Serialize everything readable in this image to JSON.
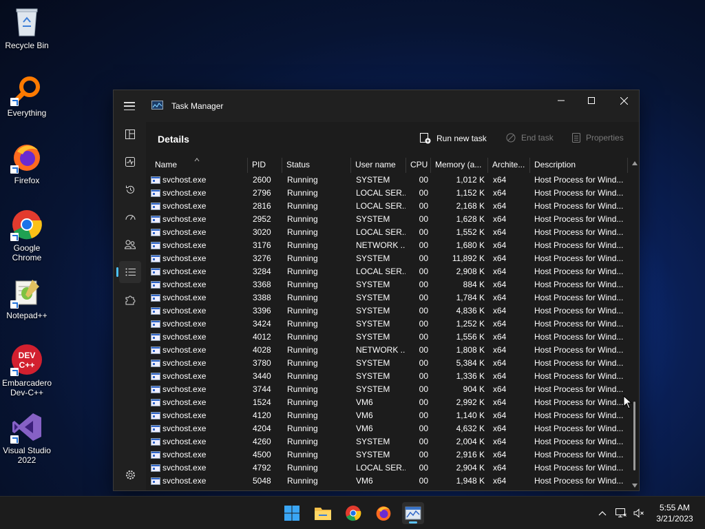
{
  "desktop": {
    "icons": [
      {
        "label": "Recycle Bin"
      },
      {
        "label": "Everything"
      },
      {
        "label": "Firefox"
      },
      {
        "label": "Google Chrome"
      },
      {
        "label": "Notepad++"
      },
      {
        "label": "Embarcadero Dev-C++"
      },
      {
        "label": "Visual Studio 2022"
      }
    ]
  },
  "window": {
    "title": "Task Manager",
    "page_title": "Details",
    "commands": {
      "run_new_task": "Run new task",
      "end_task": "End task",
      "properties": "Properties"
    },
    "columns": [
      "Name",
      "PID",
      "Status",
      "User name",
      "CPU",
      "Memory (a...",
      "Archite...",
      "Description"
    ],
    "rows": [
      {
        "name": "svchost.exe",
        "pid": "2600",
        "status": "Running",
        "user": "SYSTEM",
        "cpu": "00",
        "mem": "1,012 K",
        "arch": "x64",
        "desc": "Host Process for Wind..."
      },
      {
        "name": "svchost.exe",
        "pid": "2796",
        "status": "Running",
        "user": "LOCAL SER...",
        "cpu": "00",
        "mem": "1,152 K",
        "arch": "x64",
        "desc": "Host Process for Wind..."
      },
      {
        "name": "svchost.exe",
        "pid": "2816",
        "status": "Running",
        "user": "LOCAL SER...",
        "cpu": "00",
        "mem": "2,168 K",
        "arch": "x64",
        "desc": "Host Process for Wind..."
      },
      {
        "name": "svchost.exe",
        "pid": "2952",
        "status": "Running",
        "user": "SYSTEM",
        "cpu": "00",
        "mem": "1,628 K",
        "arch": "x64",
        "desc": "Host Process for Wind..."
      },
      {
        "name": "svchost.exe",
        "pid": "3020",
        "status": "Running",
        "user": "LOCAL SER...",
        "cpu": "00",
        "mem": "1,552 K",
        "arch": "x64",
        "desc": "Host Process for Wind..."
      },
      {
        "name": "svchost.exe",
        "pid": "3176",
        "status": "Running",
        "user": "NETWORK ...",
        "cpu": "00",
        "mem": "1,680 K",
        "arch": "x64",
        "desc": "Host Process for Wind..."
      },
      {
        "name": "svchost.exe",
        "pid": "3276",
        "status": "Running",
        "user": "SYSTEM",
        "cpu": "00",
        "mem": "11,892 K",
        "arch": "x64",
        "desc": "Host Process for Wind..."
      },
      {
        "name": "svchost.exe",
        "pid": "3284",
        "status": "Running",
        "user": "LOCAL SER...",
        "cpu": "00",
        "mem": "2,908 K",
        "arch": "x64",
        "desc": "Host Process for Wind..."
      },
      {
        "name": "svchost.exe",
        "pid": "3368",
        "status": "Running",
        "user": "SYSTEM",
        "cpu": "00",
        "mem": "884 K",
        "arch": "x64",
        "desc": "Host Process for Wind..."
      },
      {
        "name": "svchost.exe",
        "pid": "3388",
        "status": "Running",
        "user": "SYSTEM",
        "cpu": "00",
        "mem": "1,784 K",
        "arch": "x64",
        "desc": "Host Process for Wind..."
      },
      {
        "name": "svchost.exe",
        "pid": "3396",
        "status": "Running",
        "user": "SYSTEM",
        "cpu": "00",
        "mem": "4,836 K",
        "arch": "x64",
        "desc": "Host Process for Wind..."
      },
      {
        "name": "svchost.exe",
        "pid": "3424",
        "status": "Running",
        "user": "SYSTEM",
        "cpu": "00",
        "mem": "1,252 K",
        "arch": "x64",
        "desc": "Host Process for Wind..."
      },
      {
        "name": "svchost.exe",
        "pid": "4012",
        "status": "Running",
        "user": "SYSTEM",
        "cpu": "00",
        "mem": "1,556 K",
        "arch": "x64",
        "desc": "Host Process for Wind..."
      },
      {
        "name": "svchost.exe",
        "pid": "4028",
        "status": "Running",
        "user": "NETWORK ...",
        "cpu": "00",
        "mem": "1,808 K",
        "arch": "x64",
        "desc": "Host Process for Wind..."
      },
      {
        "name": "svchost.exe",
        "pid": "3780",
        "status": "Running",
        "user": "SYSTEM",
        "cpu": "00",
        "mem": "5,384 K",
        "arch": "x64",
        "desc": "Host Process for Wind..."
      },
      {
        "name": "svchost.exe",
        "pid": "3440",
        "status": "Running",
        "user": "SYSTEM",
        "cpu": "00",
        "mem": "1,336 K",
        "arch": "x64",
        "desc": "Host Process for Wind..."
      },
      {
        "name": "svchost.exe",
        "pid": "3744",
        "status": "Running",
        "user": "SYSTEM",
        "cpu": "00",
        "mem": "904 K",
        "arch": "x64",
        "desc": "Host Process for Wind..."
      },
      {
        "name": "svchost.exe",
        "pid": "1524",
        "status": "Running",
        "user": "VM6",
        "cpu": "00",
        "mem": "2,992 K",
        "arch": "x64",
        "desc": "Host Process for Wind..."
      },
      {
        "name": "svchost.exe",
        "pid": "4120",
        "status": "Running",
        "user": "VM6",
        "cpu": "00",
        "mem": "1,140 K",
        "arch": "x64",
        "desc": "Host Process for Wind..."
      },
      {
        "name": "svchost.exe",
        "pid": "4204",
        "status": "Running",
        "user": "VM6",
        "cpu": "00",
        "mem": "4,632 K",
        "arch": "x64",
        "desc": "Host Process for Wind..."
      },
      {
        "name": "svchost.exe",
        "pid": "4260",
        "status": "Running",
        "user": "SYSTEM",
        "cpu": "00",
        "mem": "2,004 K",
        "arch": "x64",
        "desc": "Host Process for Wind..."
      },
      {
        "name": "svchost.exe",
        "pid": "4500",
        "status": "Running",
        "user": "SYSTEM",
        "cpu": "00",
        "mem": "2,916 K",
        "arch": "x64",
        "desc": "Host Process for Wind..."
      },
      {
        "name": "svchost.exe",
        "pid": "4792",
        "status": "Running",
        "user": "LOCAL SER...",
        "cpu": "00",
        "mem": "2,904 K",
        "arch": "x64",
        "desc": "Host Process for Wind..."
      },
      {
        "name": "svchost.exe",
        "pid": "5048",
        "status": "Running",
        "user": "VM6",
        "cpu": "00",
        "mem": "1,948 K",
        "arch": "x64",
        "desc": "Host Process for Wind..."
      }
    ]
  },
  "taskbar": {
    "time": "5:55 AM",
    "date": "3/21/2023"
  },
  "colors": {
    "accent": "#4cc2ff",
    "window_bg": "#202020",
    "content_bg": "#1c1c1c",
    "disabled_text": "#7a7a7a"
  }
}
